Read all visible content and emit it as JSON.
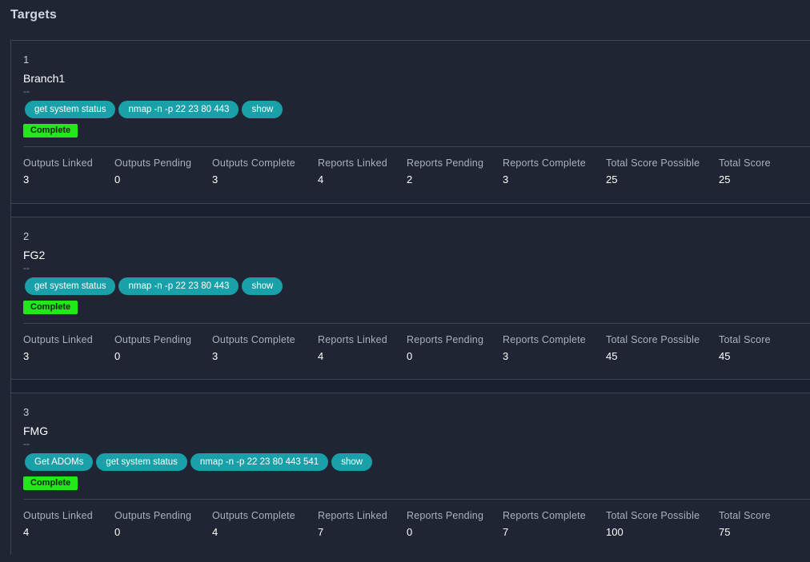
{
  "page": {
    "title": "Targets"
  },
  "stat_labels": {
    "outputs_linked": "Outputs Linked",
    "outputs_pending": "Outputs Pending",
    "outputs_complete": "Outputs Complete",
    "reports_linked": "Reports Linked",
    "reports_pending": "Reports Pending",
    "reports_complete": "Reports Complete",
    "total_score_possible": "Total Score Possible",
    "total_score": "Total Score"
  },
  "targets": [
    {
      "number": "1",
      "name": "Branch1",
      "description": "--",
      "commands": [
        "get system status",
        "nmap -n -p 22 23 80 443",
        "show"
      ],
      "status": "Complete",
      "stats": {
        "outputs_linked": "3",
        "outputs_pending": "0",
        "outputs_complete": "3",
        "reports_linked": "4",
        "reports_pending": "2",
        "reports_complete": "3",
        "total_score_possible": "25",
        "total_score": "25"
      }
    },
    {
      "number": "2",
      "name": "FG2",
      "description": "--",
      "commands": [
        "get system status",
        "nmap -n -p 22 23 80 443",
        "show"
      ],
      "status": "Complete",
      "stats": {
        "outputs_linked": "3",
        "outputs_pending": "0",
        "outputs_complete": "3",
        "reports_linked": "4",
        "reports_pending": "0",
        "reports_complete": "3",
        "total_score_possible": "45",
        "total_score": "45"
      }
    },
    {
      "number": "3",
      "name": "FMG",
      "description": "--",
      "commands": [
        "Get ADOMs",
        "get system status",
        "nmap -n -p 22 23 80 443 541",
        "show"
      ],
      "status": "Complete",
      "stats": {
        "outputs_linked": "4",
        "outputs_pending": "0",
        "outputs_complete": "4",
        "reports_linked": "7",
        "reports_pending": "0",
        "reports_complete": "7",
        "total_score_possible": "100",
        "total_score": "75"
      }
    }
  ]
}
